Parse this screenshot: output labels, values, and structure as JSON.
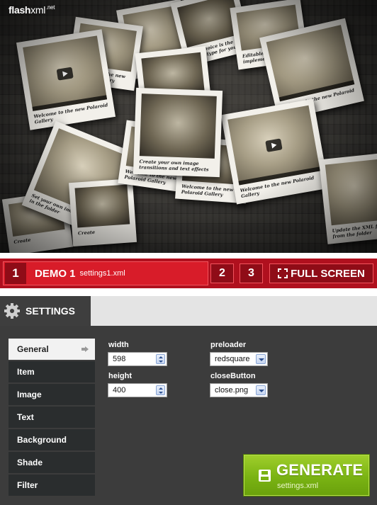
{
  "logo": {
    "brand_bold": "flash",
    "brand_thin": "xml",
    "suffix": ".net"
  },
  "gallery": {
    "captions": [
      "Welcome to the new Polaroid Gallery",
      "Welcome to the new Polaroid Gallery",
      "Your choice is the fitting type for your photo",
      "Editable s implementation options",
      "Welcome to the new Polaroid Gallery",
      "Create your own image transitions and text effects",
      "Welcome to the new Polaroid Gallery",
      "Set your own images and text in the folder",
      "Update the XML files from the folder accordingly",
      "Create"
    ]
  },
  "demo_bar": {
    "active_number": "1",
    "title": "DEMO 1",
    "file": "settings1.xml",
    "button_2": "2",
    "button_3": "3",
    "fullscreen_label": "FULL SCREEN"
  },
  "settings": {
    "tab_label": "SETTINGS",
    "menu": [
      "General",
      "Item",
      "Image",
      "Text",
      "Background",
      "Shade",
      "Filter"
    ],
    "active_menu_index": 0,
    "fields": {
      "width_label": "width",
      "width_value": "598",
      "height_label": "height",
      "height_value": "400",
      "preloader_label": "preloader",
      "preloader_value": "redsquare",
      "close_label": "closeButton",
      "close_value": "close.png"
    },
    "generate": {
      "label": "GENERATE",
      "sub": "settings.xml"
    }
  },
  "colors": {
    "accent_red": "#b0101e",
    "generate_green": "#7ab313",
    "panel_dark": "#3c3c3c"
  }
}
